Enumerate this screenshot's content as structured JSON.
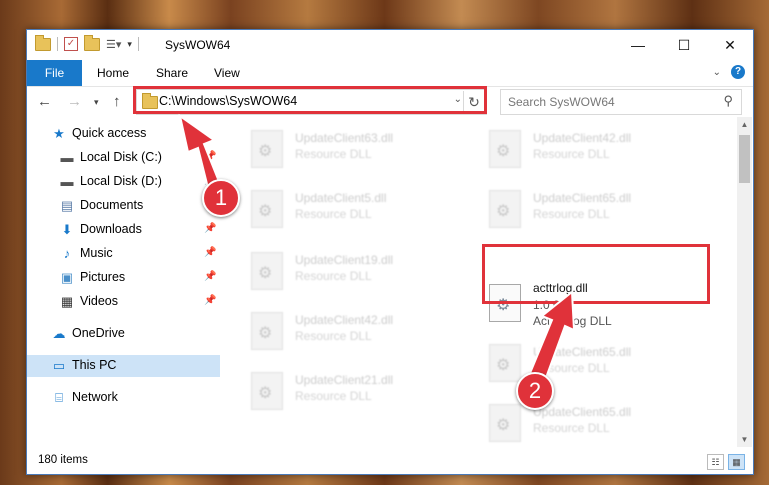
{
  "window": {
    "title": "SysWOW64",
    "min_icon": "minimize-icon",
    "max_icon": "maximize-icon",
    "close_icon": "close-icon"
  },
  "ribbon": {
    "tabs": [
      "File",
      "Home",
      "Share",
      "View"
    ]
  },
  "address": {
    "path": "C:\\Windows\\SysWOW64"
  },
  "search": {
    "placeholder": "Search SysWOW64"
  },
  "sidebar": {
    "items": [
      {
        "label": "Quick access",
        "icon": "star-icon"
      },
      {
        "label": "Local Disk (C:)",
        "icon": "drive-icon"
      },
      {
        "label": "Local Disk (D:)",
        "icon": "drive-icon"
      },
      {
        "label": "Documents",
        "icon": "documents-icon"
      },
      {
        "label": "Downloads",
        "icon": "download-icon"
      },
      {
        "label": "Music",
        "icon": "music-icon"
      },
      {
        "label": "Pictures",
        "icon": "pictures-icon"
      },
      {
        "label": "Videos",
        "icon": "videos-icon"
      },
      {
        "label": "OneDrive",
        "icon": "cloud-icon"
      },
      {
        "label": "This PC",
        "icon": "computer-icon"
      },
      {
        "label": "Network",
        "icon": "network-icon"
      }
    ],
    "selected": "This PC"
  },
  "files": {
    "left": [
      {
        "name": "UpdateClient63.dll",
        "desc": "Resource DLL"
      },
      {
        "name": "UpdateClient5.dll",
        "desc": "Resource DLL"
      },
      {
        "name": "UpdateClient19.dll",
        "desc": "Resource DLL"
      },
      {
        "name": "UpdateClient42.dll",
        "desc": "Resource DLL"
      },
      {
        "name": "UpdateClient21.dll",
        "desc": "Resource DLL"
      }
    ],
    "right": [
      {
        "name": "UpdateClient42.dll",
        "desc": "Resource DLL"
      },
      {
        "name": "UpdateClient65.dll",
        "desc": "Resource DLL"
      },
      {
        "name": "acttrlog.dll",
        "version": "1.0.0.1",
        "desc": "ActTRLog DLL"
      },
      {
        "name": "UpdateClient65.dll",
        "desc": "Resource DLL"
      },
      {
        "name": "UpdateClient65.dll",
        "desc": "Resource DLL"
      }
    ]
  },
  "status": {
    "count": "180 items"
  },
  "markers": {
    "one": "1",
    "two": "2"
  },
  "colors": {
    "highlight": "#e0323a",
    "accent": "#1979ca",
    "selection": "#cde3f7"
  }
}
